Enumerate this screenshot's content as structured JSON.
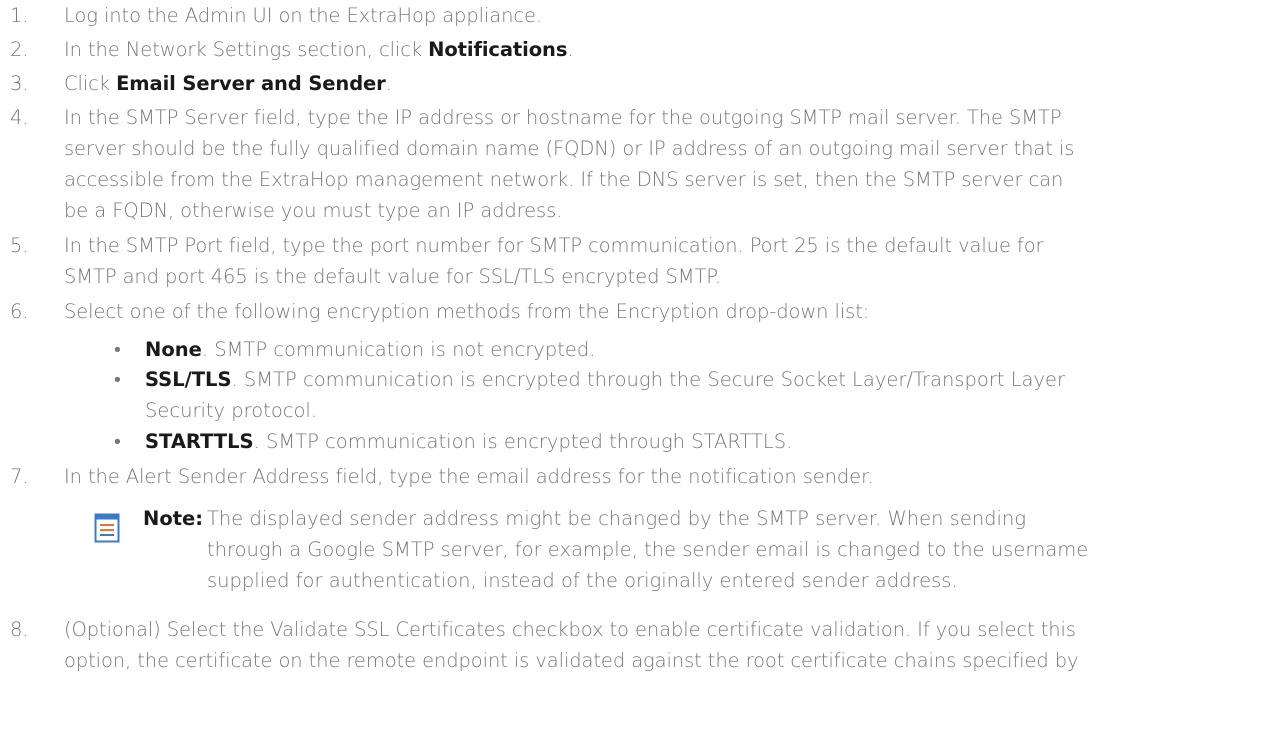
{
  "steps": [
    {
      "n": "1.",
      "lines": [
        "Log into the Admin UI on the ExtraHop appliance."
      ]
    },
    {
      "n": "2.",
      "pre": "In the Network Settings section, click ",
      "bold": "Notifications",
      "post": "."
    },
    {
      "n": "3.",
      "pre": "Click ",
      "bold": "Email Server and Sender",
      "post": "."
    },
    {
      "n": "4.",
      "lines": [
        "In the SMTP Server field, type the IP address or hostname for the outgoing SMTP mail server. The SMTP",
        "server should be the fully qualified domain name (FQDN) or IP address of an outgoing mail server that is",
        "accessible from the ExtraHop management network. If the DNS server is set, then the SMTP server can",
        "be a FQDN, otherwise you must type an IP address."
      ]
    },
    {
      "n": "5.",
      "lines": [
        "In the SMTP Port field, type the port number for SMTP communication. Port 25 is the default value for",
        "SMTP and port 465 is the default value for SSL/TLS encrypted SMTP."
      ]
    },
    {
      "n": "6.",
      "lines": [
        "Select one of the following encryption methods from the Encryption drop-down list:"
      ]
    },
    {
      "n": "7.",
      "lines": [
        "In the Alert Sender Address field, type the email address for the notification sender."
      ]
    },
    {
      "n": "8.",
      "lines": [
        "(Optional) Select the Validate SSL Certificates checkbox to enable certificate validation. If you select this",
        "option, the certificate on the remote endpoint is validated against the root certificate chains specified by"
      ]
    }
  ],
  "bullets": [
    {
      "symbol": "•",
      "bold": "None",
      "lines": [
        ". SMTP communication is not encrypted."
      ]
    },
    {
      "symbol": "•",
      "bold": "SSL/TLS",
      "lines": [
        ". SMTP communication is encrypted through the Secure Socket Layer/Transport Layer",
        "Security protocol."
      ]
    },
    {
      "symbol": "•",
      "bold": "STARTTLS",
      "lines": [
        ". SMTP communication is encrypted through STARTTLS."
      ]
    }
  ],
  "note": {
    "icon": "note-icon",
    "label": "Note:",
    "lines": [
      "The displayed sender address might be changed by the SMTP server. When sending",
      "through a Google SMTP server, for example, the sender email is changed to the username",
      "supplied for authentication, instead of the originally entered sender address."
    ]
  },
  "colors": {
    "text": "#777777",
    "bold": "#1a1a1a",
    "note_icon": "#3a7cc4",
    "note_accent": "#e8742c"
  }
}
